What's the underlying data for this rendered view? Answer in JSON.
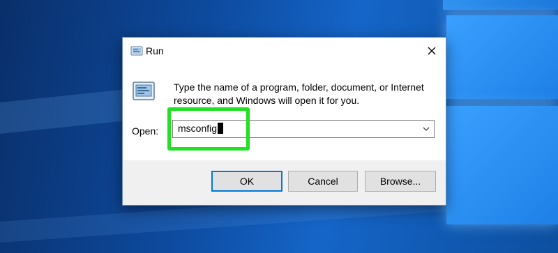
{
  "dialog": {
    "title": "Run",
    "description": "Type the name of a program, folder, document, or Internet resource, and Windows will open it for you.",
    "open_label": "Open:",
    "open_value": "msconfig",
    "buttons": {
      "ok": "OK",
      "cancel": "Cancel",
      "browse": "Browse..."
    }
  },
  "icons": {
    "title": "run-icon",
    "main": "run-icon",
    "close": "close-icon",
    "dropdown": "chevron-down-icon"
  },
  "colors": {
    "highlight": "#22e022",
    "ok_border": "#0078d7",
    "footer_bg": "#f0f0f0",
    "desktop": "#0d4a9e"
  }
}
